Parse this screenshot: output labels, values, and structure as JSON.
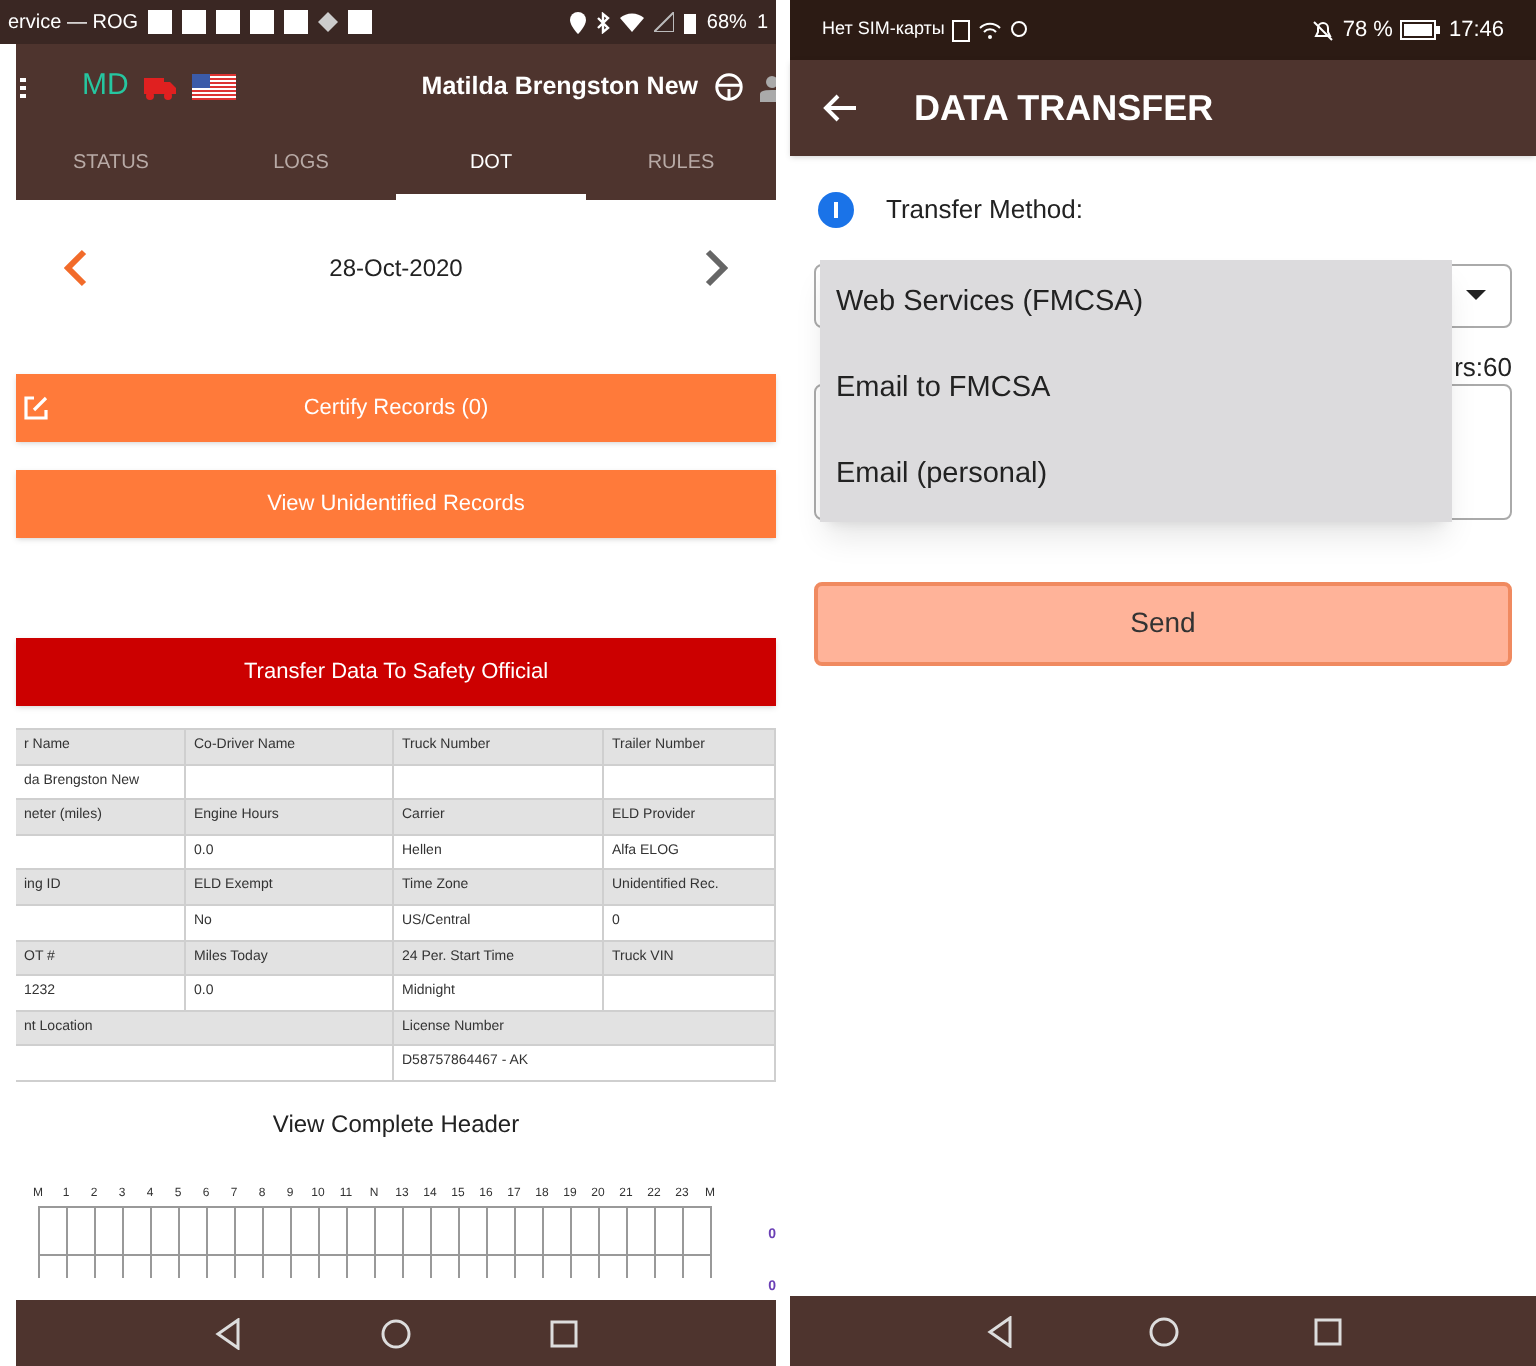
{
  "left_phone": {
    "status_bar": {
      "notification_text": "ervice — ROG",
      "battery": "68%",
      "clock": "1"
    },
    "header": {
      "initials": "MD",
      "driver": "Matilda Brengston New"
    },
    "tabs": [
      {
        "label": "STATUS",
        "selected": false
      },
      {
        "label": "LOGS",
        "selected": false
      },
      {
        "label": "DOT",
        "selected": true
      },
      {
        "label": "RULES",
        "selected": false
      }
    ],
    "date": "28-Oct-2020",
    "certify_button": "Certify Records (0)",
    "unidentified_button": "View Unidentified Records",
    "transfer_button": "Transfer Data To Safety Official",
    "table": {
      "rows": [
        {
          "kind": "header",
          "cells": [
            "r Name",
            "Co-Driver Name",
            "Truck Number",
            "Trailer Number"
          ]
        },
        {
          "kind": "value",
          "cells": [
            "da Brengston New",
            null,
            null,
            null
          ]
        },
        {
          "kind": "header",
          "cells": [
            "neter (miles)",
            "Engine Hours",
            "Carrier",
            "ELD Provider"
          ]
        },
        {
          "kind": "value",
          "cells": [
            null,
            "0.0",
            "Hellen",
            "Alfa ELOG"
          ]
        },
        {
          "kind": "header",
          "cells": [
            "ing ID",
            "ELD Exempt",
            "Time Zone",
            "Unidentified Rec."
          ]
        },
        {
          "kind": "value",
          "cells": [
            null,
            "No",
            "US/Central",
            "0"
          ]
        },
        {
          "kind": "header",
          "cells": [
            "OT #",
            "Miles Today",
            "24 Per. Start Time",
            "Truck VIN"
          ]
        },
        {
          "kind": "value",
          "cells": [
            "1232",
            "0.0",
            "Midnight",
            null
          ]
        },
        {
          "kind": "header_wide",
          "cells": [
            "nt Location",
            "License Number"
          ]
        },
        {
          "kind": "value_wide",
          "cells": [
            null,
            "D58757864467 - AK"
          ]
        }
      ]
    },
    "complete_header_link": "View Complete Header",
    "log_chart": {
      "hours": [
        "M",
        "1",
        "2",
        "3",
        "4",
        "5",
        "6",
        "7",
        "8",
        "9",
        "10",
        "11",
        "N",
        "13",
        "14",
        "15",
        "16",
        "17",
        "18",
        "19",
        "20",
        "21",
        "22",
        "23",
        "M"
      ],
      "totals": [
        "0",
        "0"
      ]
    }
  },
  "right_phone": {
    "status_bar": {
      "carrier": "Нет SIM-карты",
      "battery": "78 %",
      "clock": "17:46"
    },
    "title": "DATA TRANSFER",
    "method_label": "Transfer Method:",
    "dropdown_options": [
      "Web Services (FMCSA)",
      "Email to FMCSA",
      "Email (personal)"
    ],
    "counter": "rs:60",
    "send_button": "Send"
  }
}
